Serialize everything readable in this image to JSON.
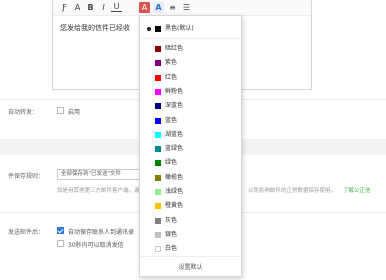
{
  "editor": {
    "toolbar": [
      {
        "glyph": "Ƒ",
        "name": "font-family-icon"
      },
      {
        "glyph": "A",
        "name": "font-size-icon"
      },
      {
        "glyph": "B",
        "name": "bold-icon"
      },
      {
        "glyph": "I",
        "name": "italic-icon"
      },
      {
        "glyph": "U",
        "name": "underline-icon"
      },
      {
        "glyph": "A",
        "name": "text-color-icon"
      },
      {
        "glyph": "A",
        "name": "background-color-icon"
      },
      {
        "glyph": "≡",
        "name": "align-icon"
      },
      {
        "glyph": "☰",
        "name": "list-icon"
      }
    ],
    "body_text": "您发给我的信件已经收"
  },
  "auto_forward": {
    "label": "自动转发：",
    "option": "启用"
  },
  "save_rule": {
    "label": "件保存规则：",
    "select_value": "全部保存到\"已发送\"文件",
    "hint_left": "如是用其他第三方邮件客户端，请",
    "hint_right": "以免影响邮件的正常数据保存使用。",
    "hint_link": "了解公正信"
  },
  "after_send": {
    "label": "发送邮件后：",
    "option1": "自动保存联系人到通讯录",
    "option2": "30秒内可以取消发信"
  },
  "color_menu": {
    "default_label": "黑色(默认)",
    "reset_label": "设置默认",
    "colors": [
      {
        "label": "暗红色",
        "color": "#8b0000"
      },
      {
        "label": "紫色",
        "color": "#800080"
      },
      {
        "label": "红色",
        "color": "#ff0000"
      },
      {
        "label": "鲜粉色",
        "color": "#ff00ff"
      },
      {
        "label": "深蓝色",
        "color": "#00008b"
      },
      {
        "label": "蓝色",
        "color": "#0000ff"
      },
      {
        "label": "湖蓝色",
        "color": "#00ffff"
      },
      {
        "label": "蓝绿色",
        "color": "#008b8b"
      },
      {
        "label": "绿色",
        "color": "#008000"
      },
      {
        "label": "橄榄色",
        "color": "#808000"
      },
      {
        "label": "浅绿色",
        "color": "#90ee90"
      },
      {
        "label": "橙黄色",
        "color": "#ffc000"
      },
      {
        "label": "灰色",
        "color": "#808080"
      },
      {
        "label": "银色",
        "color": "#c0c0c0"
      },
      {
        "label": "白色",
        "color": "#ffffff"
      }
    ]
  }
}
